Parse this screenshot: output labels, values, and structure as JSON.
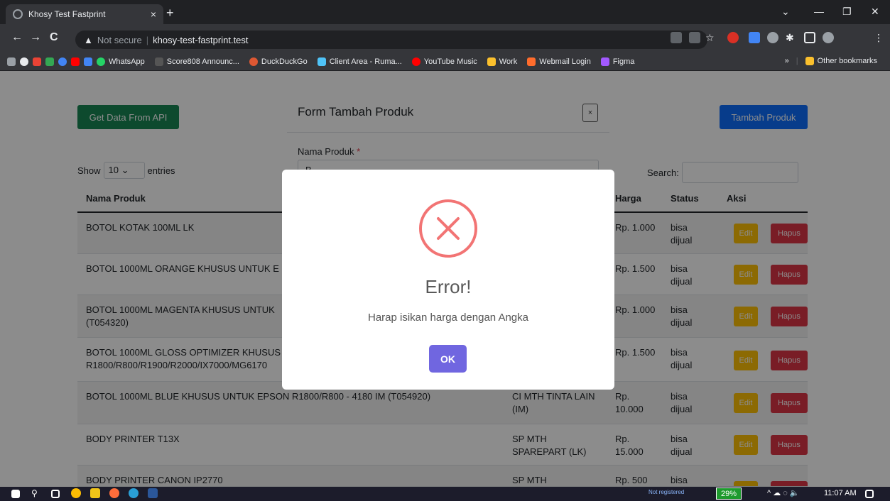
{
  "browser": {
    "tab_title": "Khosy Test Fastprint",
    "tab_close": "×",
    "new_tab": "+",
    "not_secure": "Not secure",
    "url": "khosy-test-fastprint.test",
    "back": "←",
    "forward": "→",
    "reload": "C",
    "minimize": "—",
    "maximize": "❐",
    "close": "✕",
    "bookmarks": [
      {
        "label": "WhatsApp",
        "color": "#25d366"
      },
      {
        "label": "Score808 Announc...",
        "color": "#555"
      },
      {
        "label": "DuckDuckGo",
        "color": "#de5833"
      },
      {
        "label": "Client Area - Ruma...",
        "color": "#4fc3f7"
      },
      {
        "label": "YouTube Music",
        "color": "#ff0000"
      },
      {
        "label": "Work",
        "color": "#fbc02d"
      },
      {
        "label": "Webmail Login",
        "color": "#ff6c2c"
      },
      {
        "label": "Figma",
        "color": "#a259ff"
      }
    ],
    "more_bookmarks": "»",
    "other_bookmarks": "Other bookmarks"
  },
  "page": {
    "btn_api": "Get Data From API",
    "btn_tambah": "Tambah Produk",
    "show": "Show",
    "entries_value": "10",
    "entries": "entries",
    "search": "Search:",
    "columns": [
      "Nama Produk",
      "Harga",
      "Status",
      "Aksi"
    ],
    "rows": [
      {
        "nama": "BOTOL KOTAK 100ML LK",
        "kategori": "",
        "harga": "Rp. 1.000",
        "status": "bisa dijual"
      },
      {
        "nama": "BOTOL 1000ML ORANGE KHUSUS UNTUK E",
        "kategori": "",
        "harga": "Rp. 1.500",
        "status": "bisa dijual"
      },
      {
        "nama": "BOTOL 1000ML MAGENTA KHUSUS UNTUK (T054320)",
        "kategori": "",
        "harga": "Rp. 1.000",
        "status": "bisa dijual"
      },
      {
        "nama": "BOTOL 1000ML GLOSS OPTIMIZER KHUSUS R1800/R800/R1900/R2000/IX7000/MG6170",
        "kategori": "",
        "harga": "Rp. 1.500",
        "status": "bisa dijual"
      },
      {
        "nama": "BOTOL 1000ML BLUE KHUSUS UNTUK EPSON R1800/R800 - 4180 IM (T054920)",
        "kategori": "CI MTH TINTA LAIN (IM)",
        "harga": "Rp. 10.000",
        "status": "bisa dijual"
      },
      {
        "nama": "BODY PRINTER T13X",
        "kategori": "SP MTH SPAREPART (LK)",
        "harga": "Rp. 15.000",
        "status": "bisa dijual"
      },
      {
        "nama": "BODY PRINTER CANON IP2770",
        "kategori": "SP MTH",
        "harga": "Rp. 500",
        "status": "bisa"
      }
    ],
    "edit_label": "Edit",
    "hapus_label": "Hapus"
  },
  "form_modal": {
    "title": "Form Tambah Produk",
    "close": "×",
    "label": "Nama Produk",
    "required": "*",
    "value": "B"
  },
  "alert": {
    "title": "Error!",
    "text": "Harap isikan harga dengan Angka",
    "ok": "OK",
    "icon_color": "#f27474",
    "button_color": "#7066e0"
  },
  "taskbar": {
    "not_registered": "Not registered",
    "percent": "29%",
    "time": "11:07 AM"
  }
}
